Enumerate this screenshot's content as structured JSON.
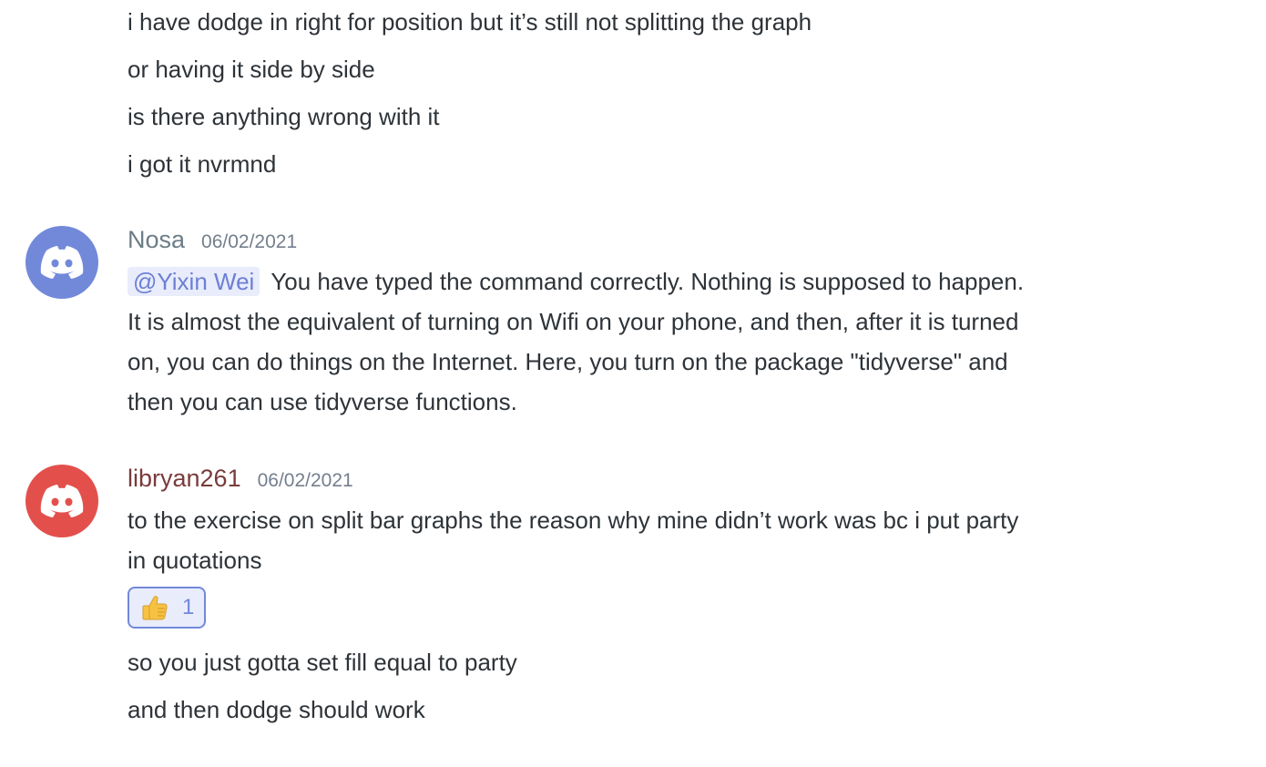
{
  "earlier_lines": [
    "i have dodge in right for position but it’s still not splitting the graph",
    "or having it side by side",
    "is there anything wrong with it",
    "i got it nvrmnd"
  ],
  "messages": [
    {
      "author": "Nosa",
      "author_color": "#6b7d87",
      "avatar_color": "#7289da",
      "timestamp": "06/02/2021",
      "mention": "@Yixin Wei",
      "lines": [
        "You have typed the command correctly. Nothing is supposed to happen.",
        "It is almost the equivalent of turning on Wifi on your phone, and then, after it is turned",
        "on, you can do things on the Internet. Here, you turn on the package \"tidyverse\" and",
        "then you can use tidyverse functions."
      ]
    },
    {
      "author": "libryan261",
      "author_color": "#7a3b3b",
      "avatar_color": "#e3504c",
      "timestamp": "06/02/2021",
      "lines": [
        "to the exercise on split bar graphs the reason why mine didn’t work was bc i put party",
        "in quotations"
      ],
      "reaction": {
        "emoji": "thumbs-up-icon",
        "count": "1"
      },
      "followups": [
        "so you just gotta set fill equal to party",
        "and then dodge should work"
      ]
    }
  ]
}
